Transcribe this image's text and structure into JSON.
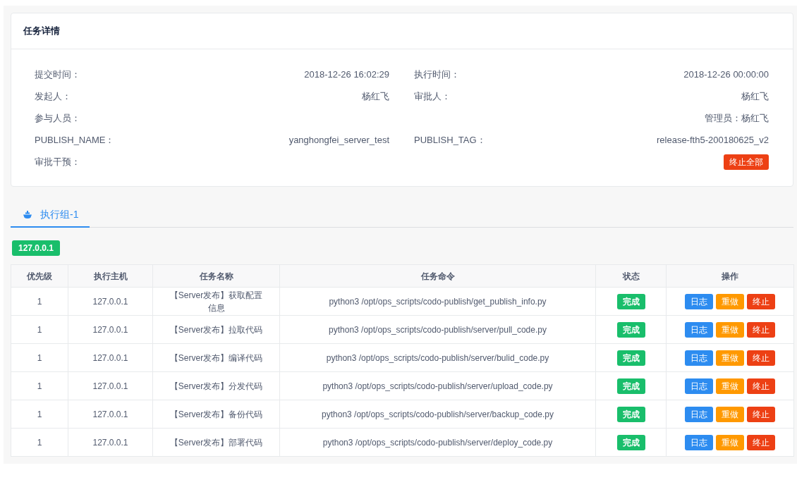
{
  "details": {
    "title": "任务详情",
    "fields": [
      {
        "kind": "field",
        "label": "提交时间：",
        "value": "2018-12-26 16:02:29"
      },
      {
        "kind": "field",
        "label": "执行时间：",
        "value": "2018-12-26 00:00:00"
      },
      {
        "kind": "field",
        "label": "发起人：",
        "value": "杨红飞"
      },
      {
        "kind": "field",
        "label": "审批人：",
        "value": "杨红飞"
      },
      {
        "kind": "field",
        "label": "参与人员："
      },
      {
        "kind": "field",
        "value": "管理员：杨红飞"
      },
      {
        "kind": "field",
        "label": "PUBLISH_NAME：",
        "value": "yanghongfei_server_test"
      },
      {
        "kind": "field",
        "label": "PUBLISH_TAG：",
        "value": "release-fth5-200180625_v2"
      },
      {
        "kind": "field",
        "label": "审批干预："
      },
      {
        "kind": "button",
        "value": "终止全部"
      }
    ]
  },
  "tabs": [
    {
      "label": "执行组-1",
      "selected": true
    }
  ],
  "host_tag": "127.0.0.1",
  "table": {
    "columns": [
      "优先级",
      "执行主机",
      "任务名称",
      "任务命令",
      "状态",
      "操作"
    ],
    "rows": [
      {
        "priority": "1",
        "host": "127.0.0.1",
        "name": "【Server发布】获取配置信息",
        "command": "python3 /opt/ops_scripts/codo-publish/get_publish_info.py",
        "status": {
          "label": "完成",
          "kind": "success"
        },
        "actions": [
          {
            "label": "日志",
            "kind": "primary"
          },
          {
            "label": "重做",
            "kind": "warning"
          },
          {
            "label": "终止",
            "kind": "error"
          }
        ]
      },
      {
        "priority": "1",
        "host": "127.0.0.1",
        "name": "【Server发布】拉取代码",
        "command": "python3 /opt/ops_scripts/codo-publish/server/pull_code.py",
        "status": {
          "label": "完成",
          "kind": "success"
        },
        "actions": [
          {
            "label": "日志",
            "kind": "primary"
          },
          {
            "label": "重做",
            "kind": "warning"
          },
          {
            "label": "终止",
            "kind": "error"
          }
        ]
      },
      {
        "priority": "1",
        "host": "127.0.0.1",
        "name": "【Server发布】编译代码",
        "command": "python3 /opt/ops_scripts/codo-publish/server/bulid_code.py",
        "status": {
          "label": "完成",
          "kind": "success"
        },
        "actions": [
          {
            "label": "日志",
            "kind": "primary"
          },
          {
            "label": "重做",
            "kind": "warning"
          },
          {
            "label": "终止",
            "kind": "error"
          }
        ]
      },
      {
        "priority": "1",
        "host": "127.0.0.1",
        "name": "【Server发布】分发代码",
        "command": "python3 /opt/ops_scripts/codo-publish/server/upload_code.py",
        "status": {
          "label": "完成",
          "kind": "success"
        },
        "actions": [
          {
            "label": "日志",
            "kind": "primary"
          },
          {
            "label": "重做",
            "kind": "warning"
          },
          {
            "label": "终止",
            "kind": "error"
          }
        ]
      },
      {
        "priority": "1",
        "host": "127.0.0.1",
        "name": "【Server发布】备份代码",
        "command": "python3 /opt/ops_scripts/codo-publish/server/backup_code.py",
        "status": {
          "label": "完成",
          "kind": "success"
        },
        "actions": [
          {
            "label": "日志",
            "kind": "primary"
          },
          {
            "label": "重做",
            "kind": "warning"
          },
          {
            "label": "终止",
            "kind": "error"
          }
        ]
      },
      {
        "priority": "1",
        "host": "127.0.0.1",
        "name": "【Server发布】部署代码",
        "command": "python3 /opt/ops_scripts/codo-publish/server/deploy_code.py",
        "status": {
          "label": "完成",
          "kind": "success"
        },
        "actions": [
          {
            "label": "日志",
            "kind": "primary"
          },
          {
            "label": "重做",
            "kind": "warning"
          },
          {
            "label": "终止",
            "kind": "error"
          }
        ]
      }
    ]
  }
}
